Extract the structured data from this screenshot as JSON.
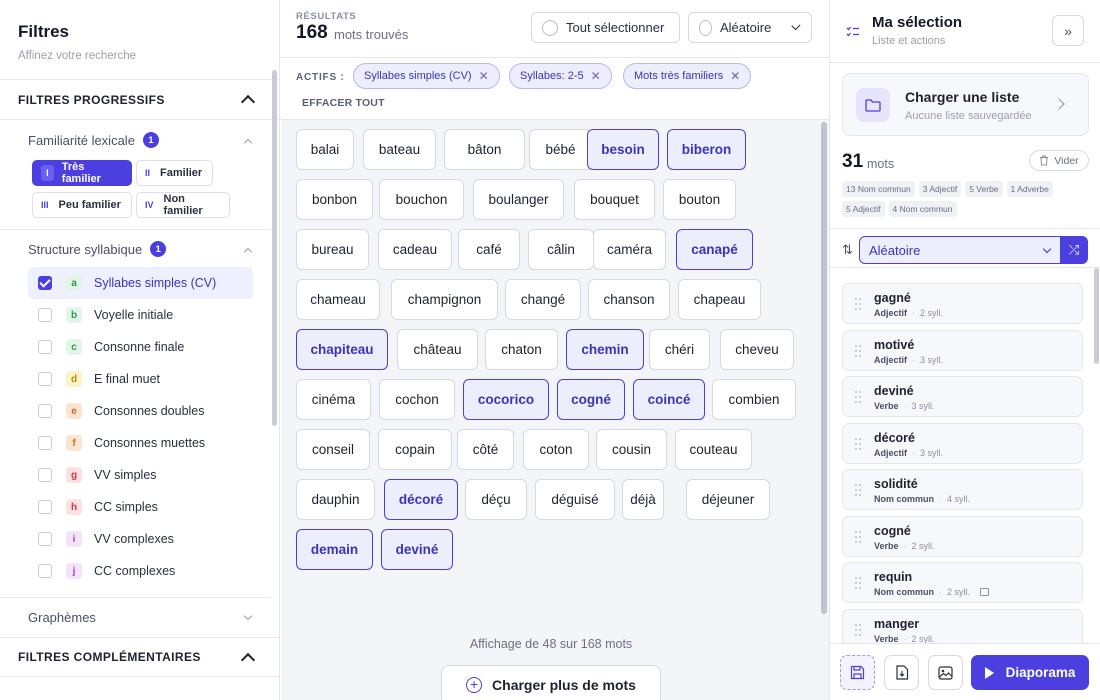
{
  "sidebar": {
    "title": "Filtres",
    "subtitle": "Affinez votre recherche",
    "progressive_title": "FILTRES PROGRESSIFS",
    "familiarity": {
      "label": "Familiarité lexicale",
      "count": "1",
      "options": [
        {
          "roman": "I",
          "label": "Très familier"
        },
        {
          "roman": "II",
          "label": "Familier"
        },
        {
          "roman": "III",
          "label": "Peu familier"
        },
        {
          "roman": "IV",
          "label": "Non familier"
        }
      ]
    },
    "structure": {
      "label": "Structure syllabique",
      "count": "1",
      "items": [
        {
          "letter": "a",
          "label": "Syllabes simples (CV)"
        },
        {
          "letter": "b",
          "label": "Voyelle initiale"
        },
        {
          "letter": "c",
          "label": "Consonne finale"
        },
        {
          "letter": "d",
          "label": "E final muet"
        },
        {
          "letter": "e",
          "label": "Consonnes doubles"
        },
        {
          "letter": "f",
          "label": "Consonnes muettes"
        },
        {
          "letter": "g",
          "label": "VV simples"
        },
        {
          "letter": "h",
          "label": "CC simples"
        },
        {
          "letter": "i",
          "label": "VV complexes"
        },
        {
          "letter": "j",
          "label": "CC complexes"
        }
      ]
    },
    "graphemes_label": "Graphèmes",
    "complementary_title": "FILTRES COMPLÉMENTAIRES"
  },
  "results": {
    "label": "RÉSULTATS",
    "count": "168",
    "unit": "mots trouvés",
    "select_all": "Tout sélectionner",
    "order": "Aléatoire"
  },
  "active_filters": {
    "label": "ACTIFS :",
    "chips": [
      "Syllabes simples (CV)",
      "Syllabes: 2-5",
      "Mots très familiers"
    ],
    "clear": "EFFACER TOUT"
  },
  "words": [
    {
      "w": "balai"
    },
    {
      "w": "bateau"
    },
    {
      "w": "bâton"
    },
    {
      "w": "bébé"
    },
    {
      "w": "besoin",
      "s": true
    },
    {
      "w": "biberon",
      "s": true
    },
    {
      "w": "bonbon"
    },
    {
      "w": "bouchon"
    },
    {
      "w": "boulanger"
    },
    {
      "w": "bouquet"
    },
    {
      "w": "bouton"
    },
    {
      "w": "bureau"
    },
    {
      "w": "cadeau"
    },
    {
      "w": "café"
    },
    {
      "w": "câlin"
    },
    {
      "w": "caméra"
    },
    {
      "w": "canapé",
      "s": true
    },
    {
      "w": "chameau"
    },
    {
      "w": "champignon"
    },
    {
      "w": "changé"
    },
    {
      "w": "chanson"
    },
    {
      "w": "chapeau"
    },
    {
      "w": "chapiteau",
      "s": true
    },
    {
      "w": "château"
    },
    {
      "w": "chaton"
    },
    {
      "w": "chemin",
      "s": true
    },
    {
      "w": "chéri"
    },
    {
      "w": "cheveu"
    },
    {
      "w": "cinéma"
    },
    {
      "w": "cochon"
    },
    {
      "w": "cocorico",
      "s": true
    },
    {
      "w": "cogné",
      "s": true
    },
    {
      "w": "coincé",
      "s": true
    },
    {
      "w": "combien"
    },
    {
      "w": "conseil"
    },
    {
      "w": "copain"
    },
    {
      "w": "côté"
    },
    {
      "w": "coton"
    },
    {
      "w": "cousin"
    },
    {
      "w": "couteau"
    },
    {
      "w": "dauphin"
    },
    {
      "w": "décoré",
      "s": true
    },
    {
      "w": "déçu"
    },
    {
      "w": "déguisé"
    },
    {
      "w": "déjà"
    },
    {
      "w": "déjeuner"
    },
    {
      "w": "demain",
      "s": true
    },
    {
      "w": "deviné",
      "s": true
    }
  ],
  "footer": {
    "showing": "Affichage de 48 sur 168 mots",
    "load_more": "Charger plus de mots"
  },
  "selection": {
    "title": "Ma sélection",
    "subtitle": "Liste et actions",
    "load_title": "Charger une liste",
    "load_sub": "Aucune liste sauvegardée",
    "count": "31",
    "unit": "mots",
    "clear": "Vider",
    "tags": [
      "13 Nom commun",
      "3 Adjectif",
      "5 Verbe",
      "1 Adverbe",
      "5 Adjectif",
      "4 Nom commun"
    ],
    "sort": "Aléatoire",
    "items": [
      {
        "word": "gagné",
        "cat": "Adjectif",
        "syll": "2 syll."
      },
      {
        "word": "motivé",
        "cat": "Adjectif",
        "syll": "3 syll."
      },
      {
        "word": "deviné",
        "cat": "Verbe",
        "syll": "3 syll."
      },
      {
        "word": "décoré",
        "cat": "Adjectif",
        "syll": "3 syll."
      },
      {
        "word": "solidité",
        "cat": "Nom commun",
        "syll": "4 syll."
      },
      {
        "word": "cogné",
        "cat": "Verbe",
        "syll": "2 syll."
      },
      {
        "word": "requin",
        "cat": "Nom commun",
        "syll": "2 syll.",
        "img": true
      },
      {
        "word": "manger",
        "cat": "Verbe",
        "syll": "2 syll."
      }
    ],
    "diaporama": "Diaporama"
  },
  "icons": {
    "accent": "#4b3fe0"
  }
}
